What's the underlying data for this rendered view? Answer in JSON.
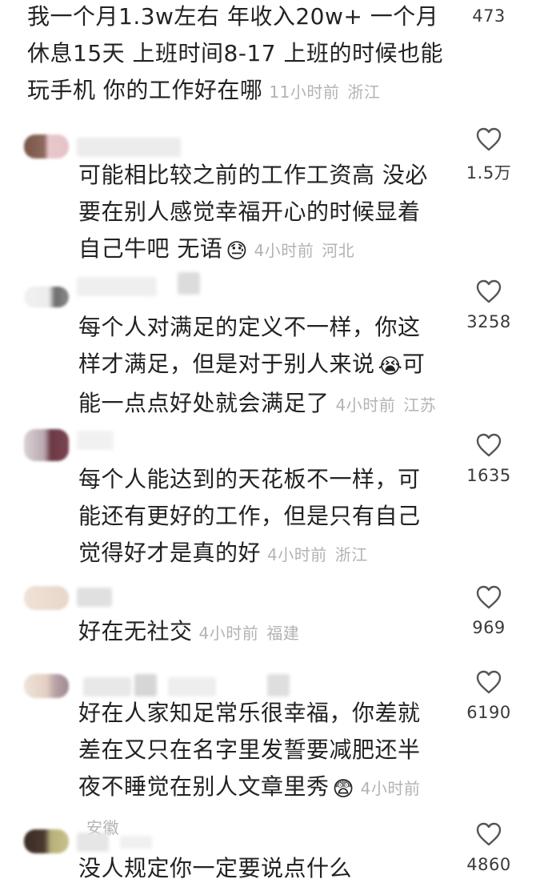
{
  "comments": [
    {
      "text": "我一个月1.3w左右 年收入20w+ 一个月休息15天 上班时间8-17 上班的时候也能玩手机 你的工作好在哪",
      "time": "11小时前",
      "location": "浙江",
      "likes": "473"
    },
    {
      "text": "可能相比较之前的工作工资高 没必要在别人感觉幸福开心的时候显着自己牛吧 无语",
      "emoji": "😓",
      "time": "4小时前",
      "location": "河北",
      "likes": "1.5万"
    },
    {
      "text": "每个人对满足的定义不一样，你这样才满足，但是对于别人来说",
      "emoji": "😭",
      "text_after": "可能一点点好处就会满足了",
      "time": "4小时前",
      "location": "江苏",
      "likes": "3258"
    },
    {
      "text": "每个人能达到的天花板不一样，可能还有更好的工作，但是只有自己觉得好才是真的好",
      "time": "4小时前",
      "location": "浙江",
      "likes": "1635"
    },
    {
      "text": "好在无社交",
      "time": "4小时前",
      "location": "福建",
      "likes": "969"
    },
    {
      "text": "好在人家知足常乐很幸福，你差就差在又只在名字里发誓要减肥还半夜不睡觉在别人文章里秀",
      "emoji": "😨",
      "time": "4小时前",
      "location": "安徽",
      "likes": "6190"
    },
    {
      "text": "没人规定你一定要说点什么",
      "likes": "4860"
    }
  ],
  "icons": {
    "like": "heart-outline-icon"
  },
  "colors": {
    "text": "#222222",
    "meta": "#b3b3b3",
    "heart_stroke": "#555555"
  }
}
